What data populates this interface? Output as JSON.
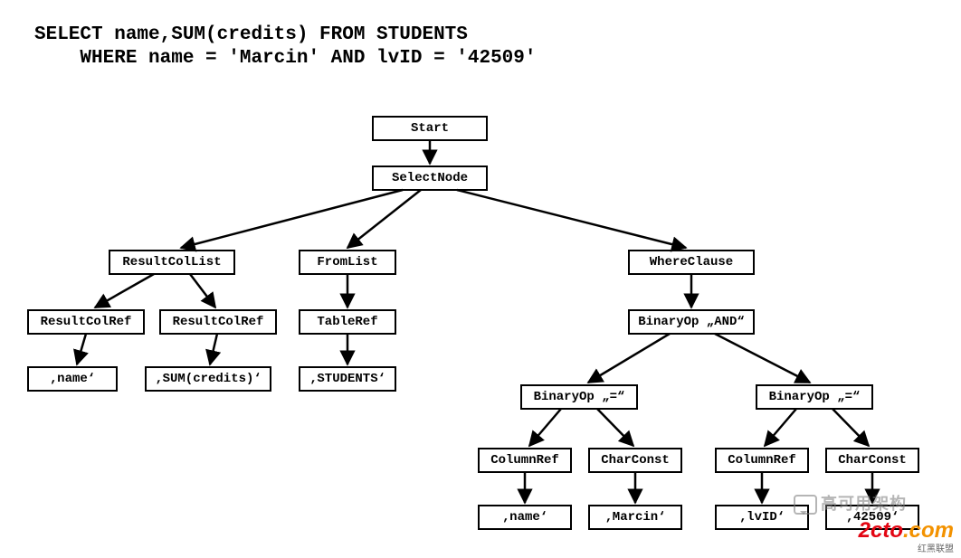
{
  "sql": {
    "line1": "SELECT name,SUM(credits) FROM STUDENTS",
    "line2": "    WHERE name = 'Marcin' AND lvID = '42509'"
  },
  "nodes": {
    "start": "Start",
    "selectNode": "SelectNode",
    "resultColList": "ResultColList",
    "fromList": "FromList",
    "whereClause": "WhereClause",
    "resultColRef1": "ResultColRef",
    "resultColRef2": "ResultColRef",
    "tableRef": "TableRef",
    "binaryAnd": "BinaryOp „AND“",
    "nameLeaf": "‚name‘",
    "sumCreditsLeaf": "‚SUM(credits)‘",
    "studentsLeaf": "‚STUDENTS‘",
    "binaryEq1": "BinaryOp „=“",
    "binaryEq2": "BinaryOp „=“",
    "colRef1": "ColumnRef",
    "charConst1": "CharConst",
    "colRef2": "ColumnRef",
    "charConst2": "CharConst",
    "nameLeaf2": "‚name‘",
    "marcinLeaf": "‚Marcin‘",
    "lvidLeaf": "‚lvID‘",
    "v42509Leaf": "‚42509‘"
  },
  "watermarks": {
    "arch": "高可用架构",
    "site": "2cto",
    "siteDotCom": ".com",
    "siteSub": "红黑联盟"
  }
}
